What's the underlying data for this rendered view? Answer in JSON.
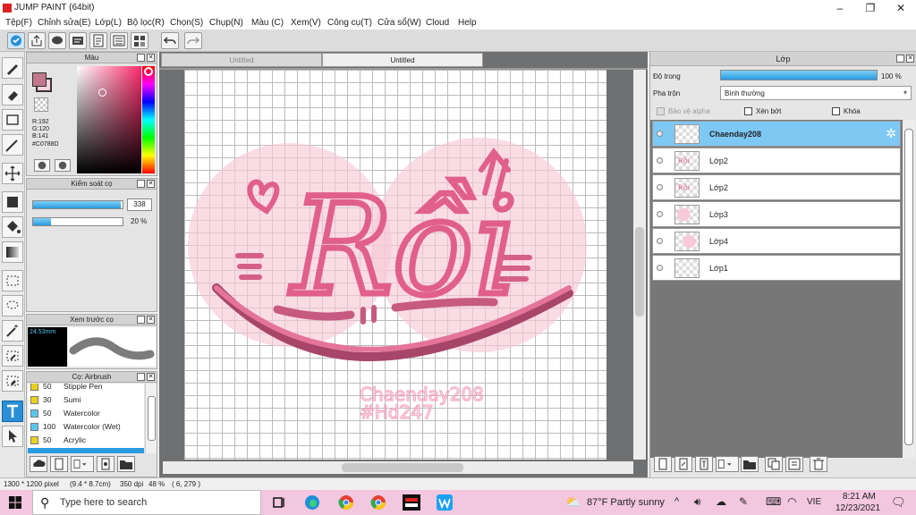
{
  "window": {
    "title": "JUMP PAINT (64bit)"
  },
  "menu": [
    "Tệp(F)",
    "Chỉnh sửa(E)",
    "Lớp(L)",
    "Bộ lọc(R)",
    "Chọn(S)",
    "Chụp(N)",
    "Màu (C)",
    "Xem(V)",
    "Công cụ(T)",
    "Cửa sổ(W)",
    "Cloud",
    "Help"
  ],
  "color_panel": {
    "title": "Màu",
    "r": "R:192",
    "g": "G:120",
    "b": "B:141",
    "hex": "#C0788D",
    "fg_color": "#c0788d",
    "bg_color": "#f8d3e0"
  },
  "brush_control": {
    "title": "Kiểm soát cọ",
    "size_value": "338",
    "size_level": 0.98,
    "opacity_value": "20 %",
    "opacity_level": 0.2
  },
  "brush_preview": {
    "title": "Xem trước cọ",
    "size_label": "24.53mm"
  },
  "brush_list": {
    "title": "Cọ: Airbrush",
    "items": [
      {
        "size": "50",
        "name": "Stipple Pen",
        "color": "#e8d21b"
      },
      {
        "size": "30",
        "name": "Sumi",
        "color": "#e8d21b"
      },
      {
        "size": "50",
        "name": "Watercolor",
        "color": "#5cc7ee"
      },
      {
        "size": "100",
        "name": "Watercolor (Wet)",
        "color": "#5cc7ee"
      },
      {
        "size": "50",
        "name": "Acrylic",
        "color": "#e8d21b"
      }
    ]
  },
  "canvas": {
    "tabs": [
      "Untitled",
      "Untitled"
    ],
    "artwork_text": "Rồi",
    "watermark_line1": "Chaenday208",
    "watermark_line2": "#Hd247"
  },
  "layer_panel": {
    "title": "Lớp",
    "opacity_label": "Độ trong",
    "opacity_value": "100 %",
    "opacity_level": 1.0,
    "blend_label": "Pha trộn",
    "blend_value": "Bình thường",
    "protect_alpha": "Bảo vệ alpha",
    "clipping": "Xén bớt",
    "lock": "Khóa",
    "layers": [
      {
        "name": "Chaenday208",
        "selected": true
      },
      {
        "name": "Lớp2",
        "selected": false
      },
      {
        "name": "Lớp2",
        "selected": false
      },
      {
        "name": "Lớp3",
        "selected": false
      },
      {
        "name": "Lớp4",
        "selected": false
      },
      {
        "name": "Lớp1",
        "selected": false
      }
    ]
  },
  "status": {
    "size": "1300 * 1200 pixel",
    "physical": "(9.4 * 8.7cm)",
    "dpi": "350 dpi",
    "zoom": "48 %",
    "coords": "( 6, 279 )"
  },
  "taskbar": {
    "search_placeholder": "Type here to search",
    "weather": "87°F  Partly sunny",
    "lang": "VIE",
    "time": "8:21 AM",
    "date": "12/23/2021"
  }
}
